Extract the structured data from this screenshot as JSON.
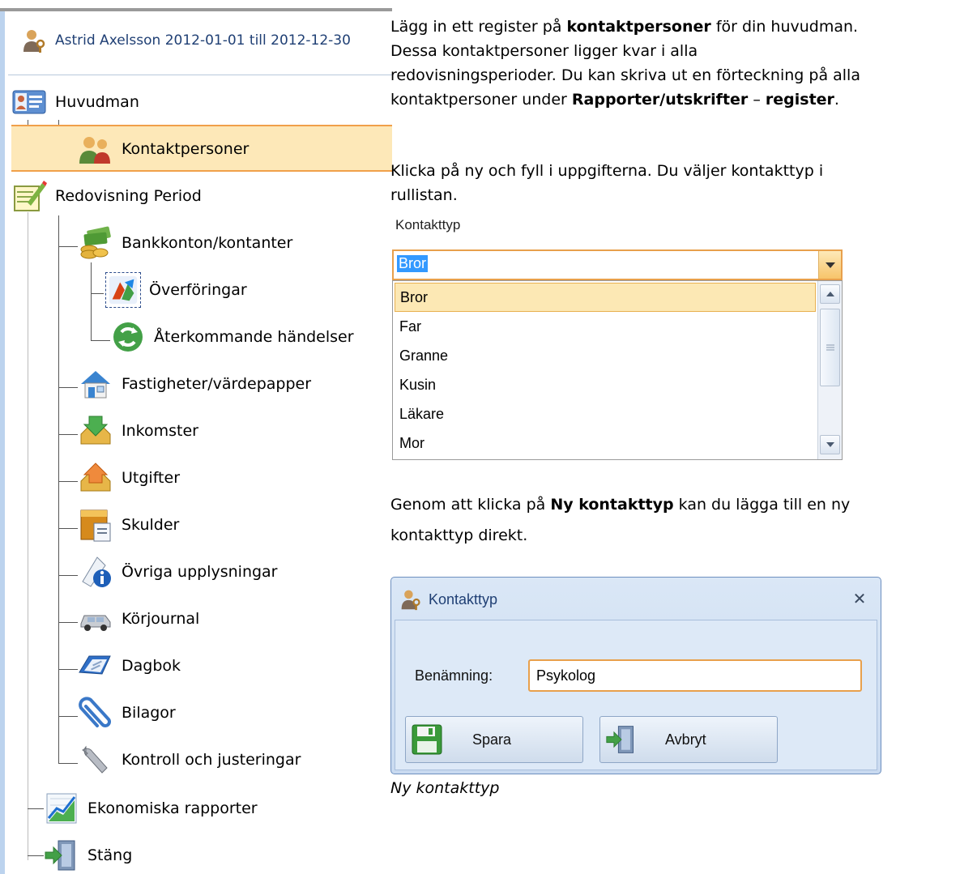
{
  "tree": {
    "header": "Astrid Axelsson 2012-01-01 till 2012-12-30",
    "nodes": {
      "huvudman": "Huvudman",
      "kontaktpersoner": "Kontaktpersoner",
      "redovisning": "Redovisning Period",
      "bankkonton": "Bankkonton/kontanter",
      "overforingar": "Överföringar",
      "aterkommande": "Återkommande händelser",
      "fastigheter": "Fastigheter/värdepapper",
      "inkomster": "Inkomster",
      "utgifter": "Utgifter",
      "skulder": "Skulder",
      "ovriga": "Övriga upplysningar",
      "korjournal": "Körjournal",
      "dagbok": "Dagbok",
      "bilagor": "Bilagor",
      "kontroll": "Kontroll och justeringar",
      "ekonomiska": "Ekonomiska rapporter",
      "stang": "Stäng"
    }
  },
  "intro": {
    "p1_a": "Lägg in ett register på ",
    "p1_b": "kontaktpersoner",
    "p1_c": " för din huvudman.",
    "p2": "Dessa kontaktpersoner ligger kvar i alla",
    "p3": "redovisningsperioder. Du kan skriva ut en förteckning på alla",
    "p4_a": "kontaktpersoner under ",
    "p4_b": "Rapporter/utskrifter",
    "p4_c": " – ",
    "p4_d": "register",
    "p4_e": ".",
    "p5": "Klicka på ny och fyll i uppgifterna. Du väljer kontakttyp i",
    "p6": "rullistan."
  },
  "dropdown": {
    "caption": "Kontakttyp",
    "value": "Bror",
    "options": [
      "Bror",
      "Far",
      "Granne",
      "Kusin",
      "Läkare",
      "Mor"
    ]
  },
  "mid": {
    "p1_a": "Genom att klicka på ",
    "p1_b": "Ny kontakttyp",
    "p1_c": " kan du lägga till en ny",
    "p2": "kontakttyp direkt."
  },
  "dialog": {
    "title": "Kontakttyp",
    "field_label": "Benämning:",
    "field_value": "Psykolog",
    "save": "Spara",
    "cancel": "Avbryt"
  },
  "caption": "Ny kontakttyp"
}
